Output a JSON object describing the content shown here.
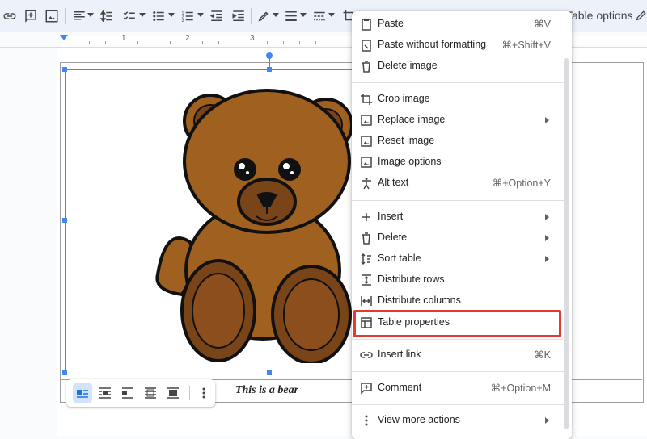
{
  "toolbar": {
    "right_label": "Table options",
    "icons": [
      "link-icon",
      "add-comment-icon",
      "insert-image-icon",
      "align-icon",
      "line-spacing-icon",
      "checklist-icon",
      "bulleted-list-icon",
      "numbered-list-icon",
      "decrease-indent-icon",
      "increase-indent-icon",
      "highlight-pen-icon",
      "border-width-icon",
      "border-dash-icon",
      "crop-icon",
      "edit-pencil-icon"
    ]
  },
  "ruler": {
    "numbers": [
      "1",
      "2",
      "3"
    ]
  },
  "document": {
    "caption": "This is a bear"
  },
  "image_toolbar": {
    "icons": [
      "inline-icon",
      "wrap-text-icon",
      "break-text-icon",
      "behind-text-icon",
      "in-front-of-text-icon",
      "more-options-icon"
    ]
  },
  "context_menu": {
    "items": [
      {
        "label": "Paste",
        "shortcut": "⌘V",
        "icon": "paste-icon"
      },
      {
        "label": "Paste without formatting",
        "shortcut": "⌘+Shift+V",
        "icon": "paste-plain-icon"
      },
      {
        "label": "Delete image",
        "shortcut": "",
        "icon": "trash-icon"
      },
      {
        "label": "Crop image",
        "shortcut": "",
        "icon": "crop-icon"
      },
      {
        "label": "Replace image",
        "shortcut": "",
        "icon": "image-icon",
        "submenu": true
      },
      {
        "label": "Reset image",
        "shortcut": "",
        "icon": "image-icon"
      },
      {
        "label": "Image options",
        "shortcut": "",
        "icon": "image-icon"
      },
      {
        "label": "Alt text",
        "shortcut": "⌘+Option+Y",
        "icon": "accessibility-icon"
      },
      {
        "label": "Insert",
        "shortcut": "",
        "icon": "plus-icon",
        "submenu": true
      },
      {
        "label": "Delete",
        "shortcut": "",
        "icon": "trash-icon",
        "submenu": true
      },
      {
        "label": "Sort table",
        "shortcut": "",
        "icon": "sort-icon",
        "submenu": true
      },
      {
        "label": "Distribute rows",
        "shortcut": "",
        "icon": "distribute-rows-icon"
      },
      {
        "label": "Distribute columns",
        "shortcut": "",
        "icon": "distribute-columns-icon"
      },
      {
        "label": "Table properties",
        "shortcut": "",
        "icon": "table-icon",
        "highlighted": true
      },
      {
        "label": "Insert link",
        "shortcut": "⌘K",
        "icon": "link-icon"
      },
      {
        "label": "Comment",
        "shortcut": "⌘+Option+M",
        "icon": "add-comment-icon"
      },
      {
        "label": "View more actions",
        "shortcut": "",
        "icon": "more-vert-icon",
        "submenu": true
      }
    ]
  },
  "colors": {
    "accent": "#4285f4",
    "highlight_box": "#e53935",
    "bear_fur": "#a0601f",
    "bear_dark": "#7a4419"
  }
}
